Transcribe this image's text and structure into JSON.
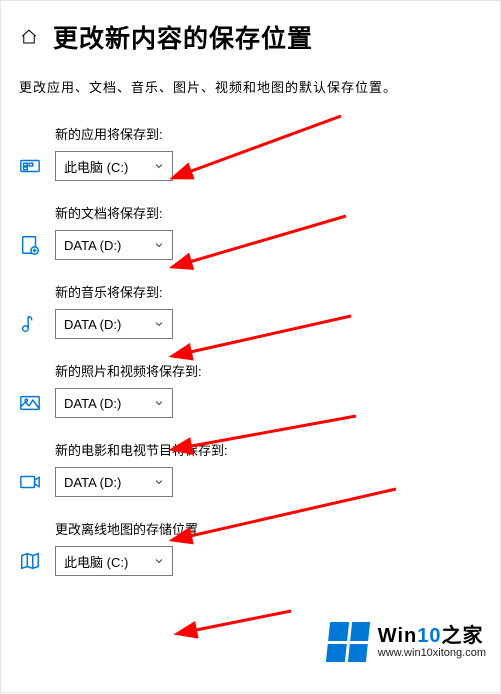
{
  "header": {
    "title": "更改新内容的保存位置"
  },
  "subtitle": "更改应用、文档、音乐、图片、视频和地图的默认保存位置。",
  "options": {
    "pc": "此电脑 (C:)",
    "data": "DATA (D:)"
  },
  "settings": [
    {
      "key": "apps",
      "label": "新的应用将保存到:",
      "value": "此电脑 (C:)",
      "icon": "apps"
    },
    {
      "key": "docs",
      "label": "新的文档将保存到:",
      "value": "DATA (D:)",
      "icon": "docs"
    },
    {
      "key": "music",
      "label": "新的音乐将保存到:",
      "value": "DATA (D:)",
      "icon": "music"
    },
    {
      "key": "photos",
      "label": "新的照片和视频将保存到:",
      "value": "DATA (D:)",
      "icon": "photos"
    },
    {
      "key": "movies",
      "label": "新的电影和电视节目将保存到:",
      "value": "DATA (D:)",
      "icon": "movies"
    },
    {
      "key": "maps",
      "label": "更改离线地图的存储位置",
      "value": "此电脑 (C:)",
      "icon": "maps"
    }
  ],
  "watermark": {
    "brand_prefix": "Win",
    "brand_num": "10",
    "brand_suffix": "之家",
    "url": "www.win10xitong.com"
  }
}
